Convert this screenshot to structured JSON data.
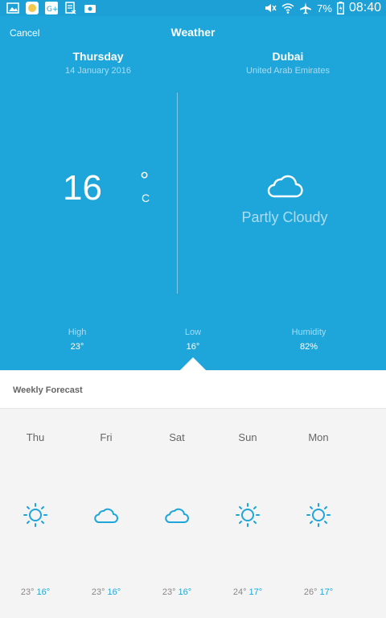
{
  "status": {
    "battery": "7%",
    "time": "08:40"
  },
  "header": {
    "cancel": "Cancel",
    "title": "Weather"
  },
  "current": {
    "day": "Thursday",
    "date": "14 January 2016",
    "city": "Dubai",
    "country": "United Arab Emirates",
    "temp": "16",
    "deg": "°",
    "unit": "C",
    "condition": "Partly Cloudy",
    "high_label": "High",
    "high": "23°",
    "low_label": "Low",
    "low": "16°",
    "humidity_label": "Humidity",
    "humidity": "82%"
  },
  "forecast": {
    "title": "Weekly Forecast",
    "days": [
      {
        "name": "Thu",
        "icon": "sun-icon",
        "hi": "23°",
        "lo": "16°"
      },
      {
        "name": "Fri",
        "icon": "cloud-icon",
        "hi": "23°",
        "lo": "16°"
      },
      {
        "name": "Sat",
        "icon": "cloud-icon",
        "hi": "23°",
        "lo": "16°"
      },
      {
        "name": "Sun",
        "icon": "sun-icon",
        "hi": "24°",
        "lo": "17°"
      },
      {
        "name": "Mon",
        "icon": "sun-icon",
        "hi": "26°",
        "lo": "17°"
      }
    ]
  },
  "colors": {
    "accent": "#1ea6da",
    "statusbar": "#1da0d6",
    "light_text": "#a7dcf2"
  }
}
